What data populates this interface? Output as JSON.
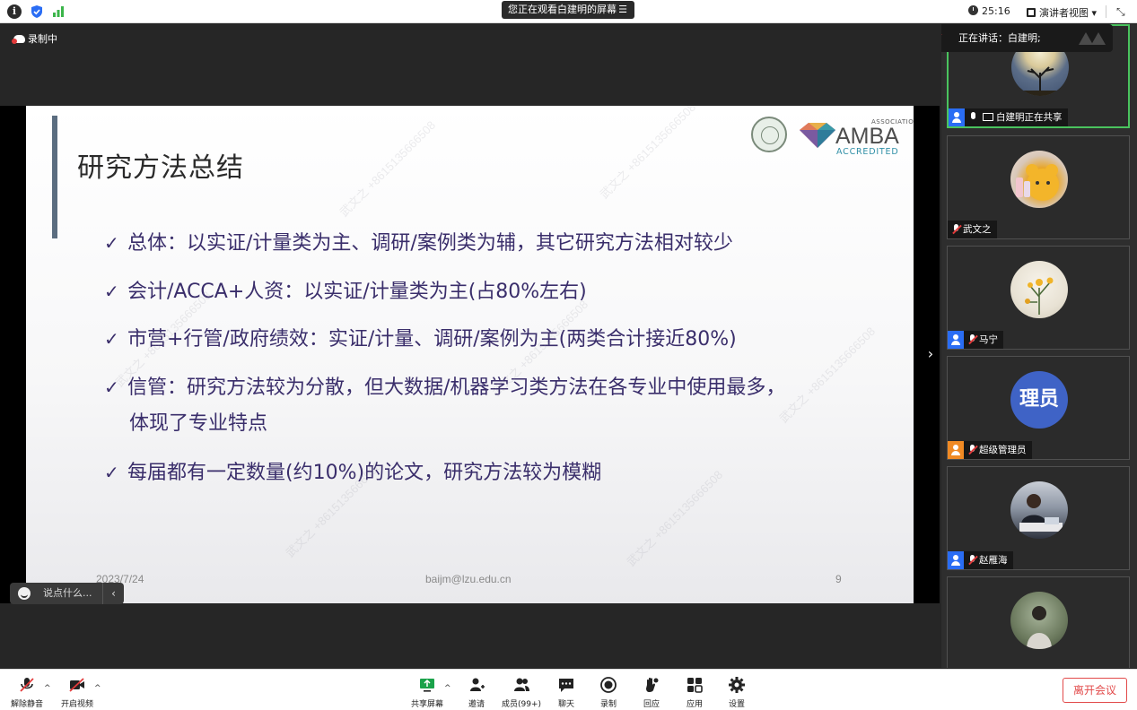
{
  "window": {
    "share_status": "您正在观看白建明的屏幕",
    "timer": "25:16",
    "view_mode": "演讲者视图",
    "recording": "录制中",
    "speaking": "正在讲话：白建明;"
  },
  "slide": {
    "title": "研究方法总结",
    "check_mark": "✓",
    "bullets": [
      "总体：以实证/计量类为主、调研/案例类为辅，其它研究方法相对较少",
      "会计/ACCA+人资：以实证/计量类为主(占80%左右)",
      "市营+行管/政府绩效：实证/计量、调研/案例为主(两类合计接近80%)",
      "信管：研究方法较为分散，但大数据/机器学习类方法在各专业中使用最多，",
      "每届都有一定数量(约10%)的论文，研究方法较为模糊"
    ],
    "bullet4_cont": "体现了专业特点",
    "footer_date": "2023/7/24",
    "footer_email": "baijm@lzu.edu.cn",
    "page_number": "9",
    "amba": {
      "association": "ASSOCIATION",
      "text": "AMBA",
      "accredited": "ACCREDITED"
    },
    "watermark": "武文之 +8615135666508"
  },
  "chat": {
    "placeholder": "说点什么..."
  },
  "participants": [
    {
      "name": "白建明正在共享",
      "avatar": "moon-tree-photo",
      "sharing": true,
      "muted": false
    },
    {
      "name": "武文之",
      "avatar": "plush-toy-photo",
      "muted": true
    },
    {
      "name": "马宁",
      "avatar": "flower-photo",
      "muted": true
    },
    {
      "name": "超级管理员",
      "avatar_text": "理员",
      "muted": true
    },
    {
      "name": "赵雁海",
      "avatar": "office-photo",
      "muted": true
    },
    {
      "name": "",
      "avatar": "woman-photo",
      "muted": true
    }
  ],
  "toolbar": {
    "unmute": "解除静音",
    "start_video": "开启视频",
    "share_screen": "共享屏幕",
    "invite": "邀请",
    "members": "成员(99+)",
    "chat": "聊天",
    "record": "录制",
    "react": "回应",
    "apps": "应用",
    "settings": "设置",
    "leave": "离开会议"
  },
  "colors": {
    "accent_green": "#4ac35e",
    "leave_red": "#e24a4a",
    "slide_text": "#3a2e6b"
  }
}
